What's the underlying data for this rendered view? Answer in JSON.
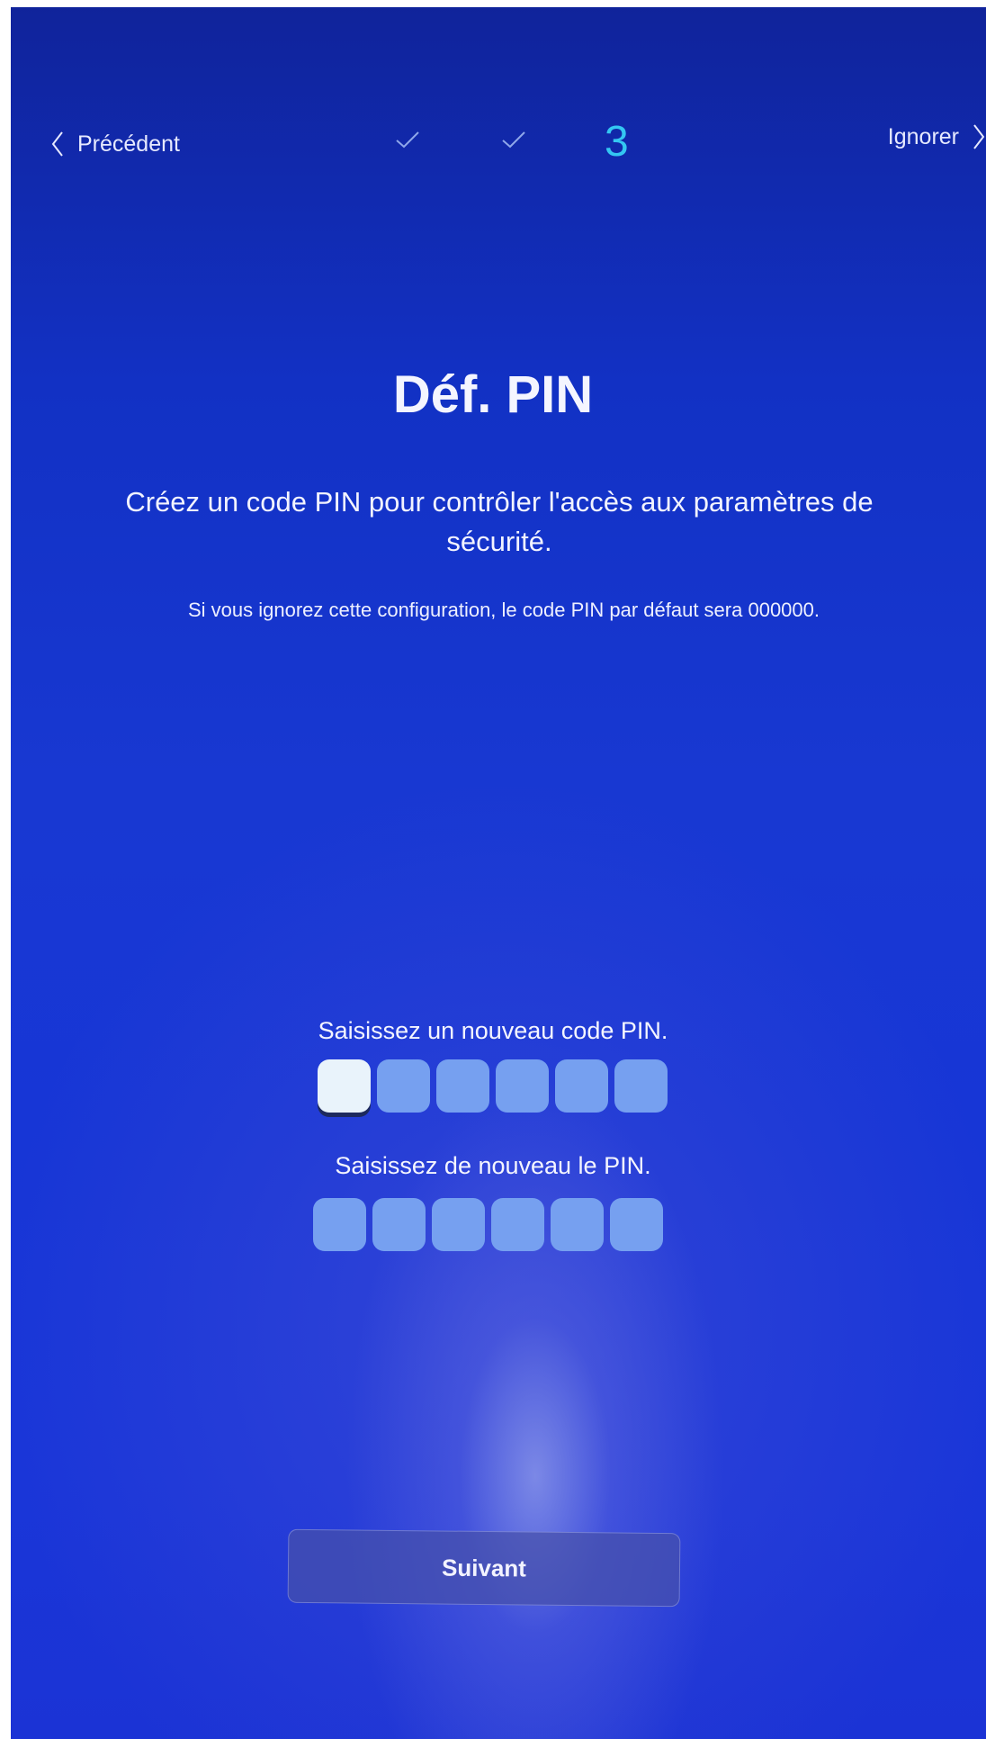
{
  "nav": {
    "back_label": "Précédent",
    "skip_label": "Ignorer",
    "current_step": "3"
  },
  "main": {
    "title": "Déf. PIN",
    "description": "Créez un code PIN pour contrôler l'accès aux paramètres de sécurité.",
    "note": "Si vous ignorez cette configuration, le code PIN par défaut sera 000000."
  },
  "pin": {
    "new_label": "Saisissez un nouveau code PIN.",
    "confirm_label": "Saisissez de nouveau le PIN.",
    "digits": 6
  },
  "footer": {
    "next_label": "Suivant"
  },
  "colors": {
    "background": "#1838d2",
    "step_accent": "#34c7f2",
    "pin_box": "#76a0f0",
    "pin_box_active": "#e9f3fb"
  }
}
